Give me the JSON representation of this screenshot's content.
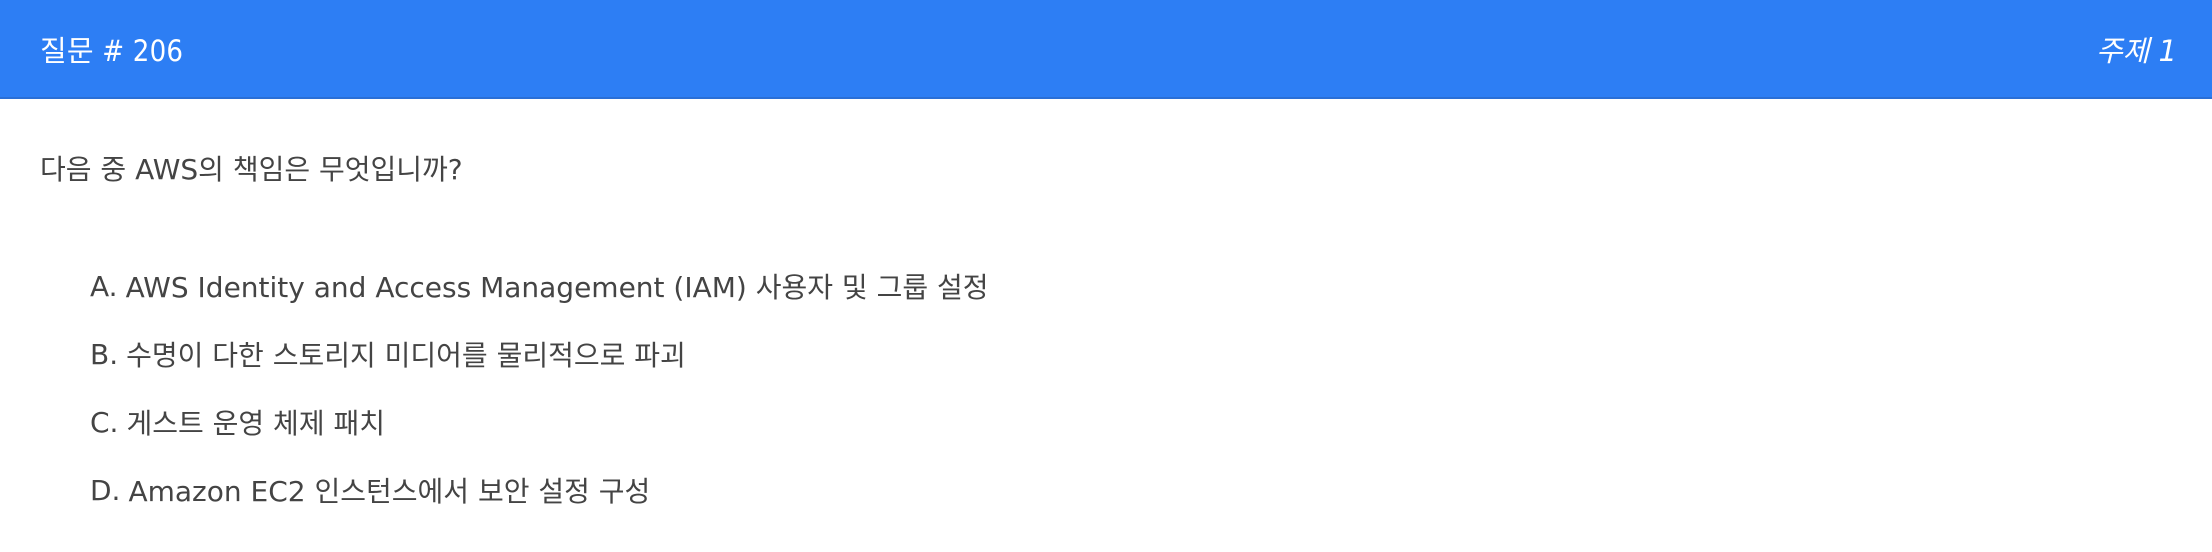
{
  "header": {
    "question_number": "질문 # 206",
    "topic": "주제 1"
  },
  "question": {
    "text": "다음 중 AWS의 책임은 무엇입니까?"
  },
  "options": [
    {
      "letter": "A.",
      "text": "AWS Identity and Access Management (IAM) 사용자 및 그룹 설정"
    },
    {
      "letter": "B.",
      "text": "수명이 다한 스토리지 미디어를 물리적으로 파괴"
    },
    {
      "letter": "C.",
      "text": "게스트 운영 체제 패치"
    },
    {
      "letter": "D.",
      "text": "Amazon EC2 인스턴스에서 보안 설정 구성"
    }
  ],
  "colors": {
    "header_bg": "#2d7ef4",
    "header_text": "#ffffff",
    "body_text": "#444444"
  }
}
